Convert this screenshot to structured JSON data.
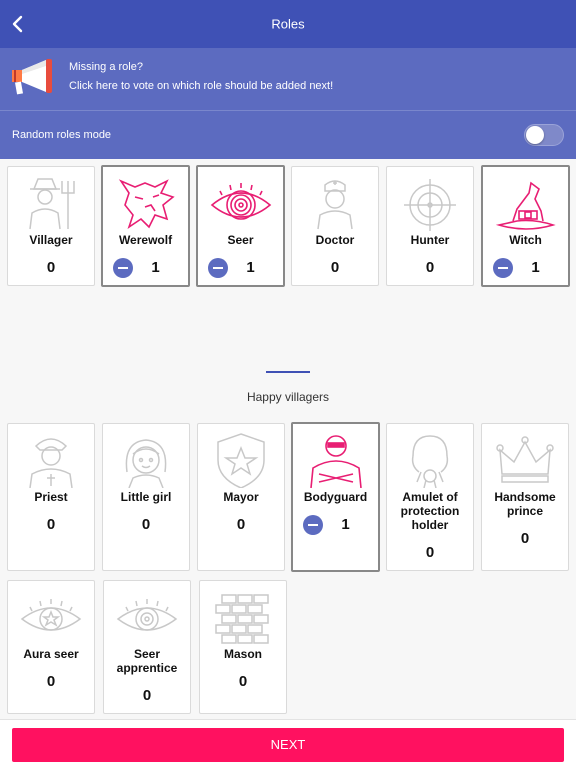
{
  "header": {
    "title": "Roles",
    "back_icon": "chevron-left-icon"
  },
  "promo": {
    "icon": "megaphone-icon",
    "title": "Missing a role?",
    "subtitle": "Click here to vote on which role should be added next!"
  },
  "random_mode": {
    "label": "Random roles mode",
    "enabled": false
  },
  "colors": {
    "primary": "#3f51b5",
    "promo_bg": "#5c6bc0",
    "accent_pink": "#ff1160",
    "role_pink": "#e81e73",
    "inactive_icon": "#c8c8c8"
  },
  "werewolves_roles": [
    {
      "name": "Villager",
      "count": "0",
      "icon": "villager-pitchfork-icon",
      "selected": false
    },
    {
      "name": "Werewolf",
      "count": "1",
      "icon": "werewolf-head-icon",
      "selected": true
    },
    {
      "name": "Seer",
      "count": "1",
      "icon": "seer-eye-icon",
      "selected": true
    },
    {
      "name": "Doctor",
      "count": "0",
      "icon": "doctor-nurse-icon",
      "selected": false
    },
    {
      "name": "Hunter",
      "count": "0",
      "icon": "crosshair-icon",
      "selected": false
    },
    {
      "name": "Witch",
      "count": "1",
      "icon": "witch-hat-icon",
      "selected": true
    }
  ],
  "happy_villagers": {
    "title": "Happy villagers",
    "roles": [
      {
        "name": "Priest",
        "count": "0",
        "icon": "priest-icon",
        "selected": false
      },
      {
        "name": "Little girl",
        "count": "0",
        "icon": "little-girl-icon",
        "selected": false
      },
      {
        "name": "Mayor",
        "count": "0",
        "icon": "mayor-badge-icon",
        "selected": false
      },
      {
        "name": "Bodyguard",
        "count": "1",
        "icon": "bodyguard-icon",
        "selected": true
      },
      {
        "name": "Amulet of protection holder",
        "count": "0",
        "icon": "amulet-icon",
        "selected": false
      },
      {
        "name": "Handsome prince",
        "count": "0",
        "icon": "crown-icon",
        "selected": false
      },
      {
        "name": "Aura seer",
        "count": "0",
        "icon": "aura-eye-icon",
        "selected": false
      },
      {
        "name": "Seer apprentice",
        "count": "0",
        "icon": "apprentice-eye-icon",
        "selected": false
      },
      {
        "name": "Mason",
        "count": "0",
        "icon": "brick-wall-icon",
        "selected": false
      }
    ]
  },
  "footer": {
    "next_label": "NEXT"
  }
}
